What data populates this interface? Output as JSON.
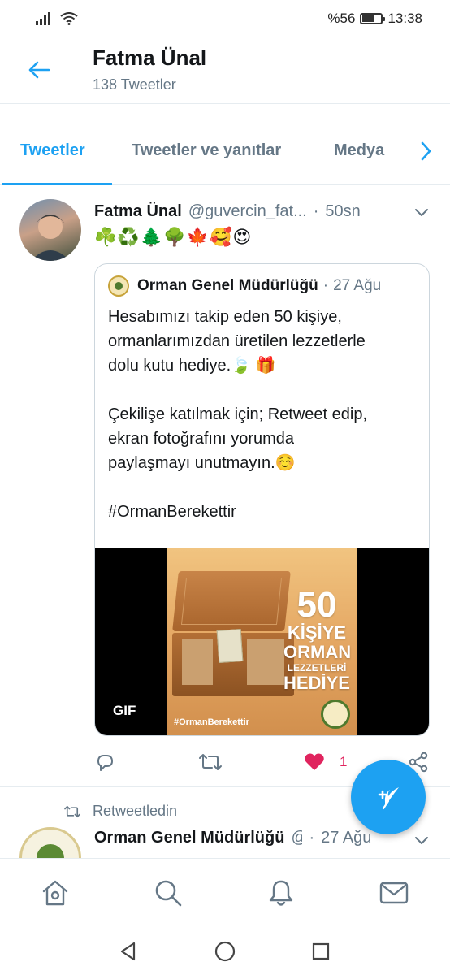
{
  "status_bar": {
    "battery_text": "%56",
    "battery_level": 0.56,
    "time": "13:38",
    "icons": [
      "signal-icon",
      "wifi-icon",
      "battery-icon"
    ]
  },
  "header": {
    "title": "Fatma Ünal",
    "subtitle": "138 Tweetler"
  },
  "tabs": [
    {
      "label": "Tweetler",
      "active": true
    },
    {
      "label": "Tweetler ve yanıtlar",
      "active": false
    },
    {
      "label": "Medya",
      "active": false
    }
  ],
  "tweet": {
    "author_name": "Fatma Ünal",
    "author_handle": "@guvercin_fat...",
    "separator": "·",
    "time": "50sn",
    "emojis": "☘️♻️🌲🌳🍁🥰😍",
    "quote": {
      "author_name": "Orman Genel Müdürlüğü",
      "separator": "·",
      "time": "27 Ağu",
      "text_lines": [
        "Hesabımızı takip eden 50 kişiye,",
        "ormanlarımızdan üretilen lezzetlerle",
        "dolu kutu hediye.🍃 🎁",
        "",
        "Çekilişe katılmak için; Retweet edip,",
        "ekran fotoğrafını yorumda",
        "paylaşmayı unutmayın.☺️",
        "",
        "#OrmanBerekettir"
      ],
      "media": {
        "badge": "GIF",
        "promo_number": "50",
        "promo_line1": "KİŞİYE",
        "promo_line2": "ORMAN",
        "promo_line3": "LEZZETLERİ",
        "promo_line4": "HEDİYE",
        "promo_tag": "#OrmanBerekettir"
      }
    },
    "actions": {
      "like_count": "1",
      "liked": true,
      "like_color": "#e0245e"
    }
  },
  "retweet_indicator": "Retweetledin",
  "tweet2": {
    "author_name": "Orman Genel Müdürlüğü",
    "author_handle": "@",
    "separator": "·",
    "time": "27 Ağu"
  },
  "colors": {
    "accent": "#1da1f2",
    "secondary_text": "#657786",
    "divider": "#e6ecf0"
  },
  "bottom_nav": [
    "home-icon",
    "search-icon",
    "notifications-icon",
    "messages-icon"
  ],
  "system_nav": [
    "back-icon",
    "home-icon",
    "recents-icon"
  ]
}
